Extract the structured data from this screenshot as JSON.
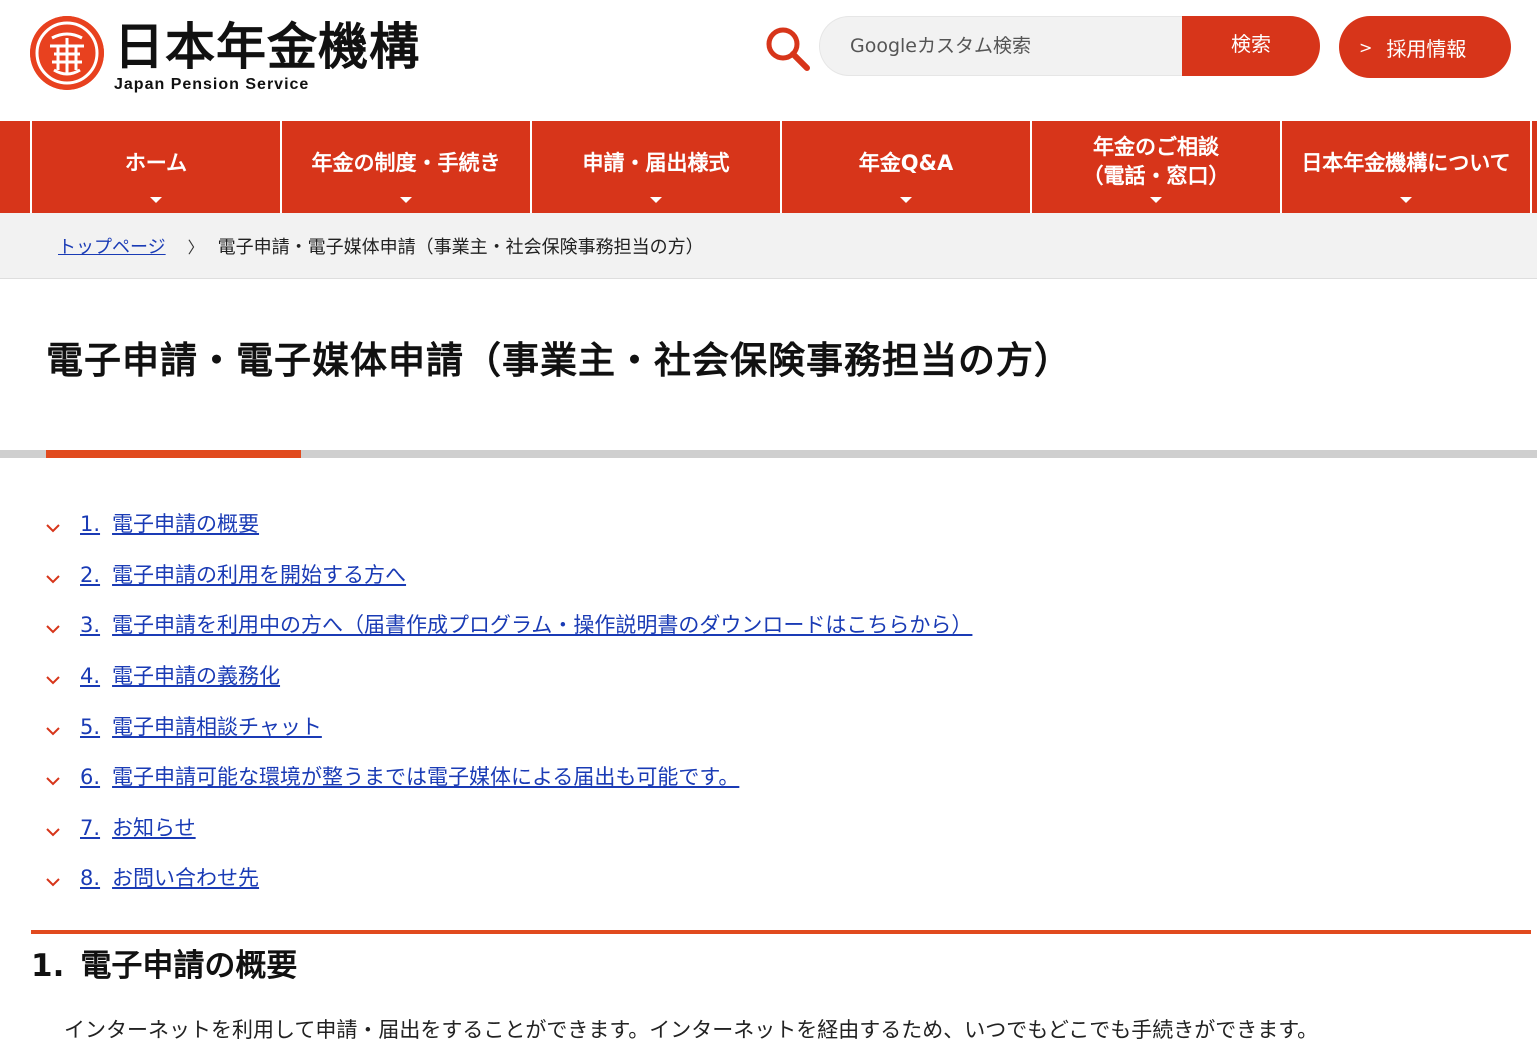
{
  "header": {
    "logo_jp": "日本年金機構",
    "logo_en": "Japan Pension Service",
    "search_placeholder": "Googleカスタム検索",
    "search_button": "検索",
    "recruit_button": "採用情報"
  },
  "nav": {
    "items": [
      {
        "label": "ホーム"
      },
      {
        "label": "年金の制度・手続き"
      },
      {
        "label": "申請・届出様式"
      },
      {
        "label": "年金Q&A"
      },
      {
        "label_line1": "年金のご相談",
        "label_line2": "（電話・窓口）"
      },
      {
        "label": "日本年金機構について"
      }
    ]
  },
  "breadcrumb": {
    "home": "トップページ",
    "separator": "〉",
    "current": "電子申請・電子媒体申請（事業主・社会保険事務担当の方）"
  },
  "page": {
    "title": "電子申請・電子媒体申請（事業主・社会保険事務担当の方）"
  },
  "toc": [
    {
      "num": "1.",
      "label": "電子申請の概要"
    },
    {
      "num": "2.",
      "label": "電子申請の利用を開始する方へ"
    },
    {
      "num": "3.",
      "label": "電子申請を利用中の方へ（届書作成プログラム・操作説明書のダウンロードはこちらから）"
    },
    {
      "num": "4.",
      "label": "電子申請の義務化"
    },
    {
      "num": "5.",
      "label": "電子申請相談チャット"
    },
    {
      "num": "6.",
      "label": "電子申請可能な環境が整うまでは電子媒体による届出も可能です。"
    },
    {
      "num": "7.",
      "label": "お知らせ"
    },
    {
      "num": "8.",
      "label": "お問い合わせ先"
    }
  ],
  "section1": {
    "num": "1.",
    "title": "電子申請の概要",
    "body": "インターネットを利用して申請・届出をすることができます。インターネットを経由するため、いつでもどこでも手続きができます。"
  },
  "colors": {
    "brand": "#d7351a",
    "link": "#1a3bb5"
  }
}
